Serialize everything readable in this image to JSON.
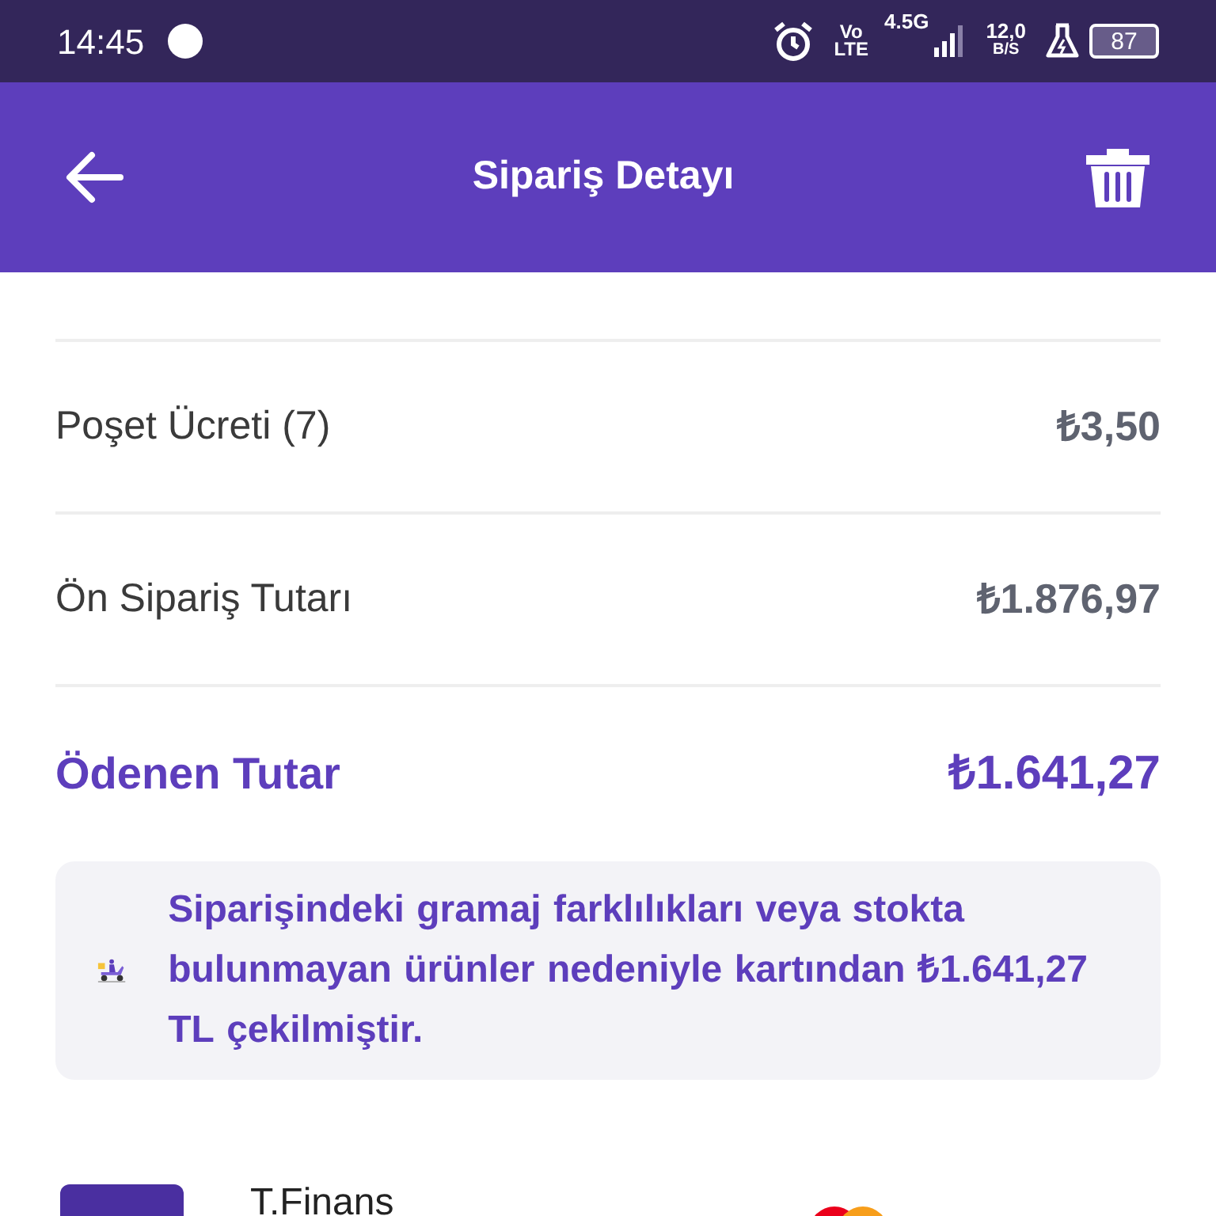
{
  "status_bar": {
    "time": "14:45",
    "volte_top": "Vo",
    "volte_bottom": "LTE",
    "network": "4.5G",
    "speed": "12,0",
    "speed_unit": "B/S",
    "battery": "87"
  },
  "header": {
    "title": "Sipariş Detayı"
  },
  "summary_rows": [
    {
      "label": "Poşet Ücreti (7)",
      "value": "₺3,50",
      "kind": "normal"
    },
    {
      "label": "Ön Sipariş Tutarı",
      "value": "₺1.876,97",
      "kind": "normal"
    },
    {
      "label": "Ödenen Tutar",
      "value": "₺1.641,27",
      "kind": "total"
    }
  ],
  "notice": {
    "text": "Siparişindeki gramaj farklılıkları veya stokta bulunmayan ürünler nedeniyle kartından **₺1.641,27 TL** çekilmiştir."
  },
  "payment_card": {
    "name": "T.Finans"
  }
}
